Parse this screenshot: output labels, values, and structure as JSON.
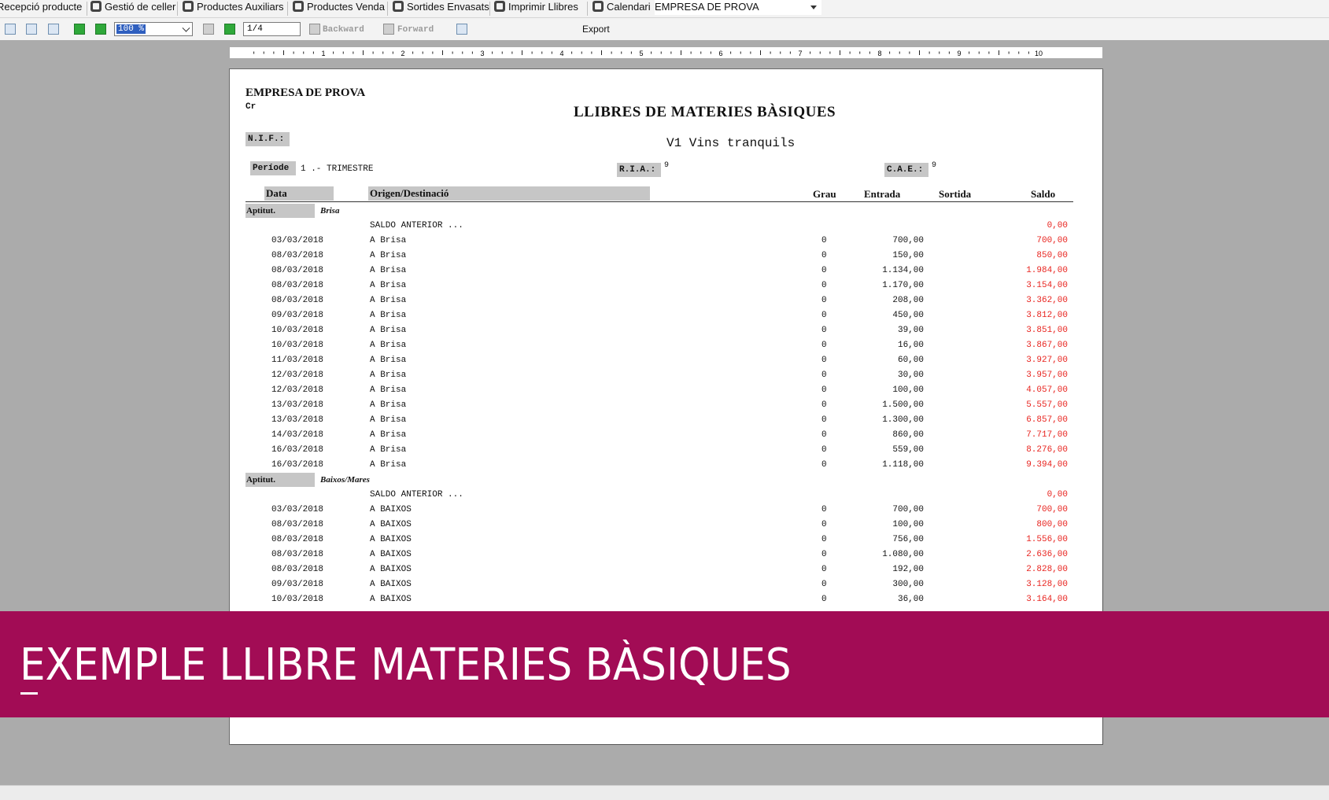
{
  "nav": {
    "items": [
      {
        "label": "Recepció producte",
        "icon": "receive-icon"
      },
      {
        "label": "Gestió de celler",
        "icon": "barrel-icon"
      },
      {
        "label": "Productes Auxiliars",
        "icon": "aux-products-icon"
      },
      {
        "label": "Productes Venda",
        "icon": "box-icon"
      },
      {
        "label": "Sortides Envasats",
        "icon": "sale-icon"
      },
      {
        "label": "Imprimir Llibres",
        "icon": "book-icon"
      },
      {
        "label": "Calendari",
        "icon": "calendar-icon"
      }
    ],
    "company": "EMPRESA DE PROVA"
  },
  "toolbar": {
    "zoom": "100 %",
    "page": "1/4",
    "backward": "Backward",
    "forward": "Forward",
    "export": "Export"
  },
  "ruler": {
    "marks": [
      "1",
      "2",
      "3",
      "4",
      "5",
      "6",
      "7",
      "8",
      "9",
      "10"
    ]
  },
  "report": {
    "company": "EMPRESA DE PROVA",
    "cr": "Cr",
    "title": "LLIBRES DE MATERIES BÀSIQUES",
    "subtitle": "V1 Vins tranquils",
    "nif_label": "N.I.F.:",
    "periode_label": "Període",
    "periode_value": "1 .- TRIMESTRE",
    "ria_label": "R.I.A.:",
    "ria_value": "9",
    "cae_label": "C.A.E.:",
    "cae_value": "9",
    "columns": {
      "data": "Data",
      "origen": "Origen/Destinació",
      "grau": "Grau",
      "entrada": "Entrada",
      "sortida": "Sortida",
      "saldo": "Saldo"
    },
    "aptitut_label": "Aptitut.",
    "saldo_anterior_label": "SALDO ANTERIOR ...",
    "groups": [
      {
        "aptitut": "Brisa",
        "saldo_anterior": "0,00",
        "rows": [
          {
            "date": "03/03/2018",
            "orig": "A Brisa",
            "grau": "0",
            "entrada": "700,00",
            "saldo": "700,00"
          },
          {
            "date": "08/03/2018",
            "orig": "A Brisa",
            "grau": "0",
            "entrada": "150,00",
            "saldo": "850,00"
          },
          {
            "date": "08/03/2018",
            "orig": "A Brisa",
            "grau": "0",
            "entrada": "1.134,00",
            "saldo": "1.984,00"
          },
          {
            "date": "08/03/2018",
            "orig": "A Brisa",
            "grau": "0",
            "entrada": "1.170,00",
            "saldo": "3.154,00"
          },
          {
            "date": "08/03/2018",
            "orig": "A Brisa",
            "grau": "0",
            "entrada": "208,00",
            "saldo": "3.362,00"
          },
          {
            "date": "09/03/2018",
            "orig": "A Brisa",
            "grau": "0",
            "entrada": "450,00",
            "saldo": "3.812,00"
          },
          {
            "date": "10/03/2018",
            "orig": "A Brisa",
            "grau": "0",
            "entrada": "39,00",
            "saldo": "3.851,00"
          },
          {
            "date": "10/03/2018",
            "orig": "A Brisa",
            "grau": "0",
            "entrada": "16,00",
            "saldo": "3.867,00"
          },
          {
            "date": "11/03/2018",
            "orig": "A Brisa",
            "grau": "0",
            "entrada": "60,00",
            "saldo": "3.927,00"
          },
          {
            "date": "12/03/2018",
            "orig": "A Brisa",
            "grau": "0",
            "entrada": "30,00",
            "saldo": "3.957,00"
          },
          {
            "date": "12/03/2018",
            "orig": "A Brisa",
            "grau": "0",
            "entrada": "100,00",
            "saldo": "4.057,00"
          },
          {
            "date": "13/03/2018",
            "orig": "A Brisa",
            "grau": "0",
            "entrada": "1.500,00",
            "saldo": "5.557,00"
          },
          {
            "date": "13/03/2018",
            "orig": "A Brisa",
            "grau": "0",
            "entrada": "1.300,00",
            "saldo": "6.857,00"
          },
          {
            "date": "14/03/2018",
            "orig": "A Brisa",
            "grau": "0",
            "entrada": "860,00",
            "saldo": "7.717,00"
          },
          {
            "date": "16/03/2018",
            "orig": "A Brisa",
            "grau": "0",
            "entrada": "559,00",
            "saldo": "8.276,00"
          },
          {
            "date": "16/03/2018",
            "orig": "A Brisa",
            "grau": "0",
            "entrada": "1.118,00",
            "saldo": "9.394,00"
          }
        ]
      },
      {
        "aptitut": "Baixos/Mares",
        "saldo_anterior": "0,00",
        "rows": [
          {
            "date": "03/03/2018",
            "orig": "A BAIXOS",
            "grau": "0",
            "entrada": "700,00",
            "saldo": "700,00"
          },
          {
            "date": "08/03/2018",
            "orig": "A BAIXOS",
            "grau": "0",
            "entrada": "100,00",
            "saldo": "800,00"
          },
          {
            "date": "08/03/2018",
            "orig": "A BAIXOS",
            "grau": "0",
            "entrada": "756,00",
            "saldo": "1.556,00"
          },
          {
            "date": "08/03/2018",
            "orig": "A BAIXOS",
            "grau": "0",
            "entrada": "1.080,00",
            "saldo": "2.636,00"
          },
          {
            "date": "08/03/2018",
            "orig": "A BAIXOS",
            "grau": "0",
            "entrada": "192,00",
            "saldo": "2.828,00"
          },
          {
            "date": "09/03/2018",
            "orig": "A BAIXOS",
            "grau": "0",
            "entrada": "300,00",
            "saldo": "3.128,00"
          },
          {
            "date": "10/03/2018",
            "orig": "A BAIXOS",
            "grau": "0",
            "entrada": "36,00",
            "saldo": "3.164,00"
          }
        ]
      }
    ]
  },
  "banner": {
    "text": "EXEMPLE LLIBRE MATERIES BÀSIQUES",
    "color": "#a20c55"
  },
  "colors": {
    "saldo": "#e8231e",
    "label_bg": "#c6c6c6",
    "workspace": "#ababab"
  }
}
